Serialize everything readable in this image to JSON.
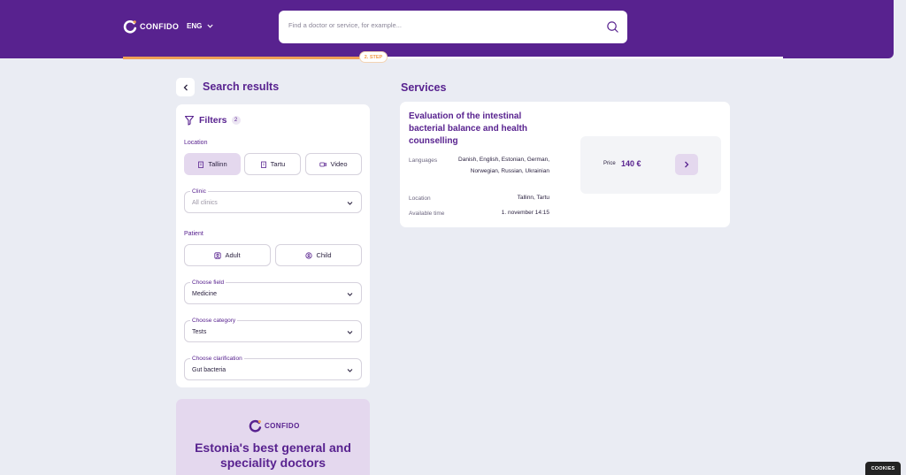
{
  "header": {
    "logo_text": "CONFIDO",
    "language": "ENG",
    "search_placeholder": "Find a doctor or service, for example...",
    "step_label": "2. STEP",
    "progress_fraction": 0.36
  },
  "sidebar": {
    "title": "Search results",
    "filters_title": "Filters",
    "filters_count": "2",
    "location_label": "Location",
    "location_options": [
      "Tallinn",
      "Tartu",
      "Video"
    ],
    "location_selected": "Tallinn",
    "clinic": {
      "label": "Clinic",
      "value": "All clinics"
    },
    "patient_label": "Patient",
    "patient_options": [
      "Adult",
      "Child"
    ],
    "field": {
      "label": "Choose field",
      "value": "Medicine"
    },
    "category": {
      "label": "Choose category",
      "value": "Tests"
    },
    "clarification": {
      "label": "Choose clarification",
      "value": "Gut bacteria"
    }
  },
  "promo": {
    "logo_text": "CONFIDO",
    "title": "Estonia's best general and speciality doctors"
  },
  "services": {
    "title": "Services",
    "items": [
      {
        "name": "Evaluation of the intestinal bacterial balance and health counselling",
        "languages_label": "Languages",
        "languages": "Danish, English, Estonian, German, Norwegian, Russian, Ukrainian",
        "location_label": "Location",
        "location": "Tallinn, Tartu",
        "time_label": "Available time",
        "time": "1. november 14:15",
        "price_label": "Price",
        "price": "140 €"
      }
    ]
  },
  "cookies_label": "COOKIES",
  "colors": {
    "brand": "#58228f",
    "accent": "#f0a057",
    "chip_active": "#e4d8ee"
  },
  "icons": [
    "confido-logo-icon",
    "chevron-down-icon",
    "search-icon",
    "back-arrow-icon",
    "filter-icon",
    "building-icon",
    "video-icon",
    "person-icon",
    "child-icon",
    "arrow-right-icon"
  ]
}
